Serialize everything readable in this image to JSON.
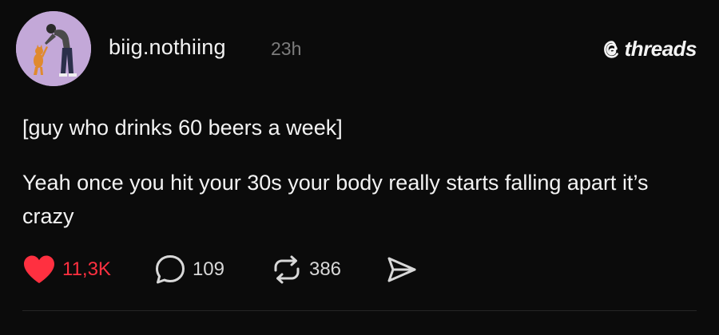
{
  "post": {
    "username": "biig.nothiing",
    "timestamp": "23h",
    "brand": "threads",
    "text_line1": "[guy who drinks 60 beers a week]",
    "text_line2": "Yeah once you hit your 30s your body really starts falling apart it’s crazy"
  },
  "actions": {
    "likes": "11,3K",
    "replies": "109",
    "reposts": "386"
  },
  "icons": {
    "like": "heart-icon",
    "reply": "speech-bubble-icon",
    "repost": "repost-arrows-icon",
    "share": "send-icon",
    "brand": "threads-logo-icon"
  },
  "colors": {
    "background": "#0b0b0b",
    "text": "#f3f3f3",
    "muted": "#7c7c7c",
    "like_red": "#ff3040",
    "avatar_bg": "#c3a8d8"
  }
}
